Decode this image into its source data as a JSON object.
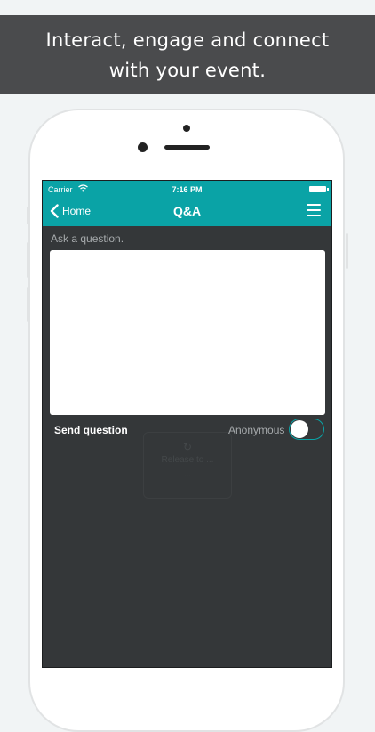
{
  "banner": {
    "line1": "Interact, engage and connect",
    "line2": "with your event."
  },
  "status_bar": {
    "carrier": "Carrier",
    "time": "7:16 PM"
  },
  "nav": {
    "back_label": "Home",
    "title": "Q&A"
  },
  "form": {
    "prompt": "Ask a question.",
    "question_value": "",
    "send_label": "Send question",
    "anonymous_label": "Anonymous",
    "anonymous_on": false
  },
  "ghost": {
    "icon": "↻",
    "line1": "Release to ...",
    "line2": "..."
  },
  "colors": {
    "accent": "#0aa3a6",
    "screen_bg": "#343739",
    "banner_bg": "#4a4b4d",
    "page_bg": "#f1f4f5"
  }
}
